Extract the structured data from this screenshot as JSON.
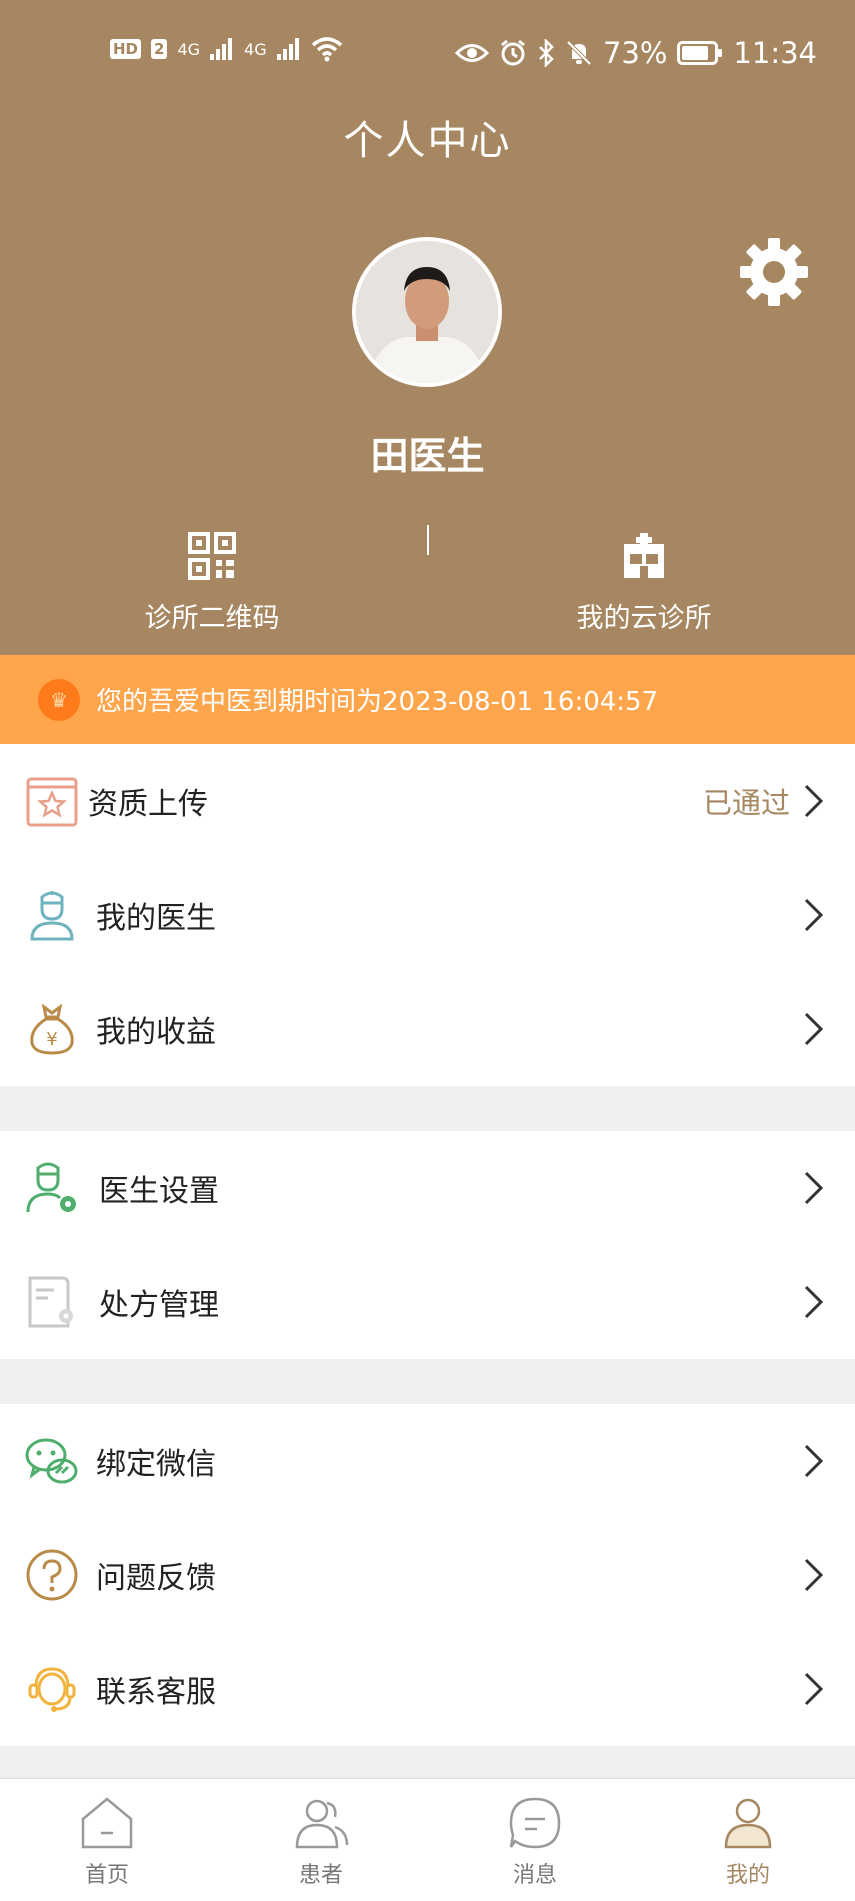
{
  "status_bar": {
    "left_badges": [
      "HD",
      "2"
    ],
    "network_1": "4G",
    "network_2": "4G",
    "battery": "73%",
    "time": "11:34"
  },
  "header": {
    "title": "个人中心",
    "user_name": "田医生",
    "quick_links": [
      {
        "label": "诊所二维码",
        "icon": "qr-code-icon"
      },
      {
        "label": "我的云诊所",
        "icon": "clinic-icon"
      }
    ]
  },
  "banner": {
    "text": "您的吾爱中医到期时间为2023-08-01 16:04:57"
  },
  "menu": {
    "group1": [
      {
        "label": "资质上传",
        "status": "已通过",
        "icon": "certificate-icon"
      },
      {
        "label": "我的医生",
        "icon": "doctor-icon"
      },
      {
        "label": "我的收益",
        "icon": "money-bag-icon"
      }
    ],
    "group2": [
      {
        "label": "医生设置",
        "icon": "doctor-settings-icon"
      },
      {
        "label": "处方管理",
        "icon": "prescription-icon"
      }
    ],
    "group3": [
      {
        "label": "绑定微信",
        "icon": "wechat-icon"
      },
      {
        "label": "问题反馈",
        "icon": "question-icon"
      },
      {
        "label": "联系客服",
        "icon": "customer-service-icon"
      }
    ]
  },
  "tabbar": {
    "tabs": [
      {
        "label": "首页",
        "icon": "home-icon"
      },
      {
        "label": "患者",
        "icon": "patients-icon"
      },
      {
        "label": "消息",
        "icon": "message-icon"
      },
      {
        "label": "我的",
        "icon": "profile-icon"
      }
    ],
    "active": "我的"
  },
  "colors": {
    "brand": "#a68761",
    "banner": "#ffa64d",
    "background": "#efefef"
  }
}
